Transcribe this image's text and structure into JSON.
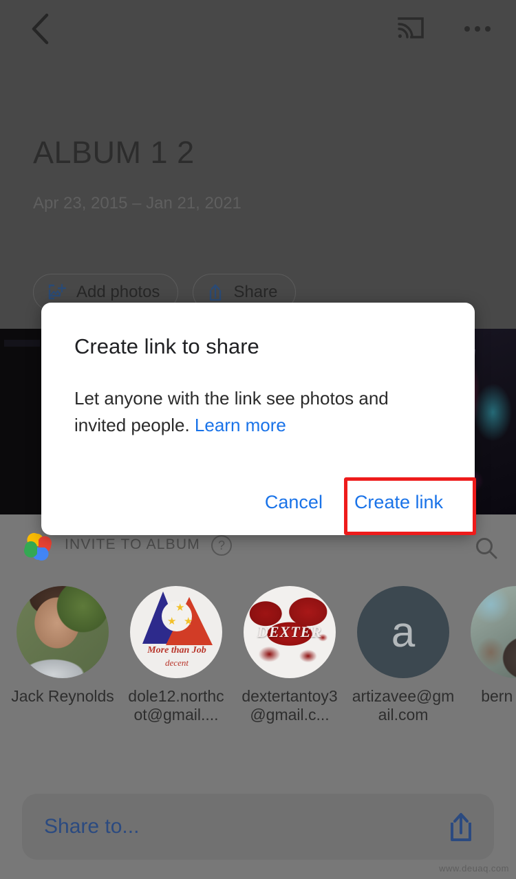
{
  "appbar": {
    "back_icon": "back-arrow-icon",
    "cast_icon": "cast-icon",
    "more_icon": "more-options-icon"
  },
  "album": {
    "title": "ALBUM 1 2",
    "date_range": "Apr 23, 2015 – Jan 21, 2021",
    "actions": [
      {
        "label": "Add photos",
        "icon": "add-photos-icon"
      },
      {
        "label": "Share",
        "icon": "share-icon"
      }
    ]
  },
  "invite": {
    "logo": "google-photos-logo",
    "header_label": "INVITE TO ALBUM",
    "help_icon": "help-icon",
    "help_glyph": "?",
    "search_icon": "search-icon",
    "people": [
      {
        "name": "Jack Reynolds",
        "avatar": "photo-avatar-jack"
      },
      {
        "name": "dole12.northcot@gmail....",
        "avatar": "logo-avatar-dole"
      },
      {
        "name": "dextertantoy3@gmail.c...",
        "avatar": "logo-avatar-dexter",
        "avatar_text": "DEXTER"
      },
      {
        "name": "artizavee@gmail.com",
        "avatar": "letter-avatar",
        "avatar_letter": "a"
      },
      {
        "name": "bern paga",
        "avatar": "photo-avatar-bern"
      }
    ],
    "share_to": {
      "label": "Share to...",
      "icon": "upload-share-icon"
    }
  },
  "dialog": {
    "title": "Create link to share",
    "body_text": "Let anyone with the link see photos and invited people. ",
    "learn_more_label": "Learn more",
    "cancel_label": "Cancel",
    "create_link_label": "Create link"
  },
  "watermark": {
    "text": "www.deuaq.com"
  },
  "colors": {
    "accent_blue": "#1a73e8",
    "share_blue": "#2b4a80",
    "highlight_red": "#ee1b1b",
    "backdrop_top": "#484848",
    "backdrop_bottom": "#787878",
    "dialog_bg": "#ffffff"
  }
}
